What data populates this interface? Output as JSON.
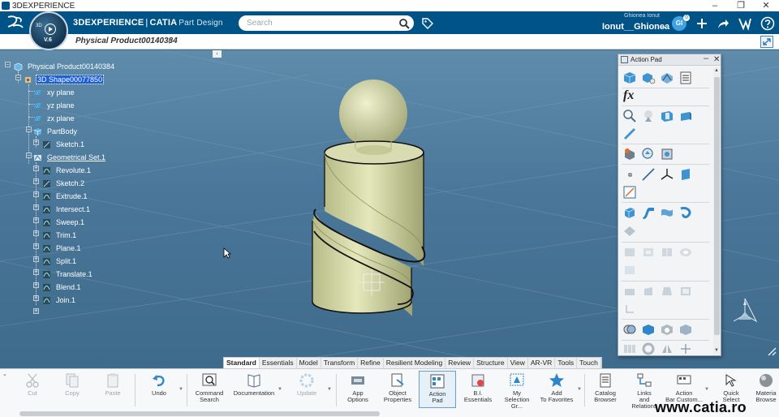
{
  "window": {
    "title": "3DEXPERIENCE",
    "controls": [
      "–",
      "❐",
      "✕"
    ]
  },
  "topbar": {
    "brand_prefix": "3DEXPERIENCE",
    "brand_sep": "|",
    "brand_catia": "CATIA",
    "brand_app": "Part Design",
    "search_placeholder": "Search",
    "user_top": "Ghionea Ionut",
    "user_name": "Ionut__Ghionea",
    "user_chevron": "⌄",
    "avatar_initials": "GI",
    "avatar_badge": "0"
  },
  "compass": {
    "label_3d": "3D",
    "version": "V.6"
  },
  "tabbar": {
    "document_tab": "Physical Product00140384",
    "add_tab": "+"
  },
  "tree": {
    "collapse": "‹",
    "nodes": [
      {
        "label": "Physical Product00140384",
        "icon": "product-icon"
      },
      {
        "label": "3D Shape00077850",
        "icon": "shape-icon",
        "selected": true
      },
      {
        "label": "xy plane",
        "icon": "plane-icon"
      },
      {
        "label": "yz plane",
        "icon": "plane-icon"
      },
      {
        "label": "zx plane",
        "icon": "plane-icon"
      },
      {
        "label": "PartBody",
        "icon": "partbody-icon"
      },
      {
        "label": "Sketch.1",
        "icon": "sketch-icon"
      },
      {
        "label": "Geometrical Set.1",
        "icon": "geoset-icon",
        "underline": true
      },
      {
        "label": "Revolute.1",
        "icon": "feature-icon"
      },
      {
        "label": "Sketch.2",
        "icon": "sketch-icon"
      },
      {
        "label": "Extrude.1",
        "icon": "feature-icon"
      },
      {
        "label": "Intersect.1",
        "icon": "feature-icon"
      },
      {
        "label": "Sweep.1",
        "icon": "feature-icon"
      },
      {
        "label": "Trim.1",
        "icon": "feature-icon"
      },
      {
        "label": "Plane.1",
        "icon": "feature-icon"
      },
      {
        "label": "Split.1",
        "icon": "feature-icon"
      },
      {
        "label": "Translate.1",
        "icon": "feature-icon"
      },
      {
        "label": "Blend.1",
        "icon": "feature-icon"
      },
      {
        "label": "Join.1",
        "icon": "feature-icon"
      }
    ]
  },
  "action_pad": {
    "title": "Action Pad",
    "minimize": "–",
    "close": "✕"
  },
  "section_tabs": [
    "Standard",
    "Essentials",
    "Model",
    "Transform",
    "Refine",
    "Resilient Modeling",
    "Review",
    "Structure",
    "View",
    "AR-VR",
    "Tools",
    "Touch"
  ],
  "active_section": "Tools",
  "action_bar": {
    "toggle": "⌄",
    "buttons": [
      {
        "label": "Cut"
      },
      {
        "label": "Copy"
      },
      {
        "label": "Paste"
      },
      {
        "label": "Undo"
      },
      {
        "label": "Command\nSearch"
      },
      {
        "label": "Documentation"
      },
      {
        "label": "Update"
      },
      {
        "label": "App\nOptions"
      },
      {
        "label": "Object\nProperties"
      },
      {
        "label": "Action\nPad"
      },
      {
        "label": "B.I.\nEssentials"
      },
      {
        "label": "My\nSelection Gr..."
      },
      {
        "label": "Add\nTo Favorites"
      },
      {
        "label": "Catalog\nBrowser"
      },
      {
        "label": "Links\nand Relations"
      },
      {
        "label": "Action\nBar Custom..."
      },
      {
        "label": "Quick\nSelect"
      },
      {
        "label": "Materia\nBrowse"
      }
    ]
  },
  "watermark": "www.catia.ro",
  "colors": {
    "topbar": "#005386",
    "model": "#cfd3a2",
    "selection": "#1d5fd9"
  }
}
